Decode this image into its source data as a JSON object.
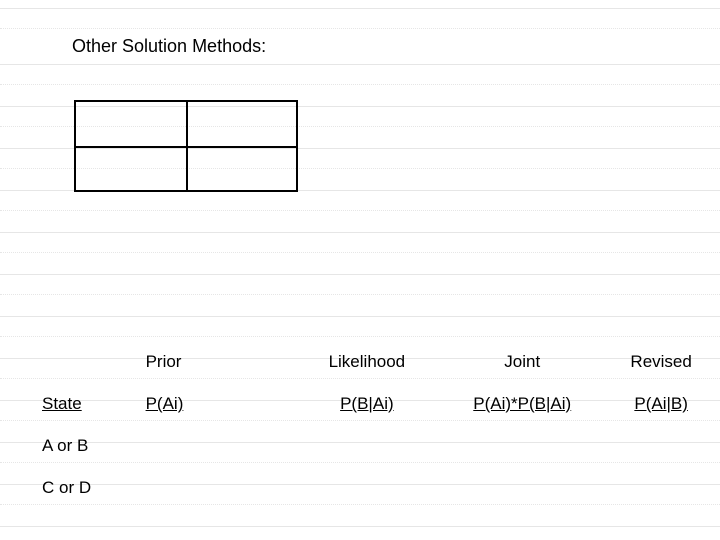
{
  "heading": "Other Solution Methods:",
  "table": {
    "headers": {
      "state": "",
      "prior": "Prior",
      "likelihood": "Likelihood",
      "joint": "Joint",
      "revised": "Revised"
    },
    "subheaders": {
      "state": "State",
      "prior": "P(Ai)",
      "likelihood": "P(B|Ai)",
      "joint": "P(Ai)*P(B|Ai)",
      "revised": "P(Ai|B)"
    },
    "rows": [
      {
        "state": "A or B"
      },
      {
        "state": "C or D"
      }
    ]
  }
}
